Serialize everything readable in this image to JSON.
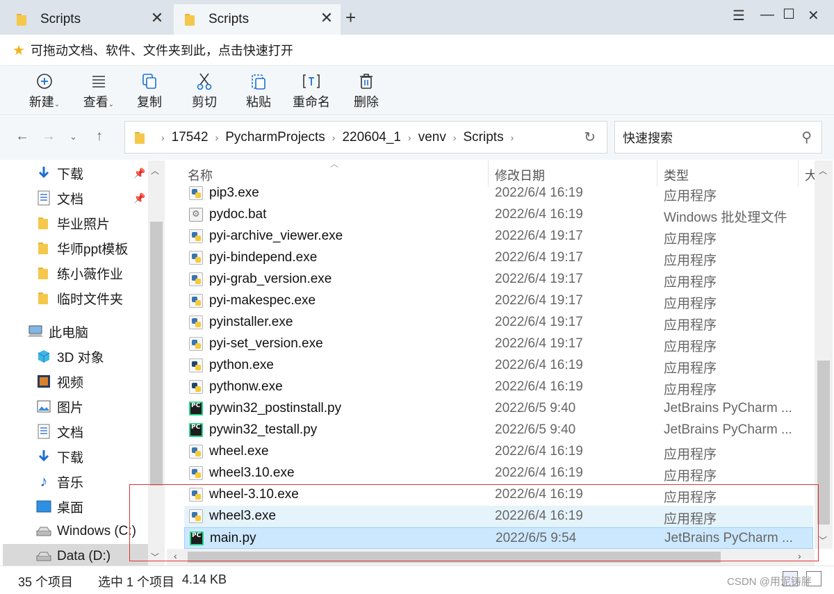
{
  "tabs": [
    {
      "label": "Scripts",
      "active": false
    },
    {
      "label": "Scripts",
      "active": true
    }
  ],
  "hint_bar": {
    "text": "可拖动文档、软件、文件夹到此，点击快速打开"
  },
  "toolbar": {
    "new": "新建",
    "view": "查看",
    "copy": "复制",
    "cut": "剪切",
    "paste": "粘贴",
    "rename": "重命名",
    "delete": "删除"
  },
  "breadcrumb": [
    "17542",
    "PycharmProjects",
    "220604_1",
    "venv",
    "Scripts"
  ],
  "search": {
    "placeholder": "快速搜索"
  },
  "nav": {
    "quick": [
      {
        "label": "下载",
        "icon": "download-icon",
        "pinned": true
      },
      {
        "label": "文档",
        "icon": "document-icon",
        "pinned": true
      },
      {
        "label": "毕业照片",
        "icon": "folder-icon",
        "pinned": false
      },
      {
        "label": "华师ppt模板",
        "icon": "folder-icon",
        "pinned": false
      },
      {
        "label": "练小薇作业",
        "icon": "folder-icon",
        "pinned": false
      },
      {
        "label": "临时文件夹",
        "icon": "folder-icon",
        "pinned": false
      }
    ],
    "this_pc": "此电脑",
    "pc_items": [
      {
        "label": "3D 对象",
        "icon": "3d-objects-icon"
      },
      {
        "label": "视频",
        "icon": "video-icon"
      },
      {
        "label": "图片",
        "icon": "pictures-icon"
      },
      {
        "label": "文档",
        "icon": "document-icon"
      },
      {
        "label": "下载",
        "icon": "download-icon"
      },
      {
        "label": "音乐",
        "icon": "music-icon"
      },
      {
        "label": "桌面",
        "icon": "desktop-icon"
      },
      {
        "label": "Windows (C:)",
        "icon": "drive-icon"
      },
      {
        "label": "Data (D:)",
        "icon": "drive-icon"
      }
    ]
  },
  "columns": {
    "name": "名称",
    "modified": "修改日期",
    "type": "类型",
    "size": "大"
  },
  "files": [
    {
      "name": "pip3.exe",
      "date": "2022/6/4 16:19",
      "type": "应用程序",
      "icon": "pyexe"
    },
    {
      "name": "pydoc.bat",
      "date": "2022/6/4 16:19",
      "type": "Windows 批处理文件",
      "icon": "bat"
    },
    {
      "name": "pyi-archive_viewer.exe",
      "date": "2022/6/4 19:17",
      "type": "应用程序",
      "icon": "pyexe"
    },
    {
      "name": "pyi-bindepend.exe",
      "date": "2022/6/4 19:17",
      "type": "应用程序",
      "icon": "pyexe"
    },
    {
      "name": "pyi-grab_version.exe",
      "date": "2022/6/4 19:17",
      "type": "应用程序",
      "icon": "pyexe"
    },
    {
      "name": "pyi-makespec.exe",
      "date": "2022/6/4 19:17",
      "type": "应用程序",
      "icon": "pyexe"
    },
    {
      "name": "pyinstaller.exe",
      "date": "2022/6/4 19:17",
      "type": "应用程序",
      "icon": "pyexe"
    },
    {
      "name": "pyi-set_version.exe",
      "date": "2022/6/4 19:17",
      "type": "应用程序",
      "icon": "pyexe"
    },
    {
      "name": "python.exe",
      "date": "2022/6/4 16:19",
      "type": "应用程序",
      "icon": "python"
    },
    {
      "name": "pythonw.exe",
      "date": "2022/6/4 16:19",
      "type": "应用程序",
      "icon": "python"
    },
    {
      "name": "pywin32_postinstall.py",
      "date": "2022/6/5 9:40",
      "type": "JetBrains PyCharm ...",
      "icon": "pycharm"
    },
    {
      "name": "pywin32_testall.py",
      "date": "2022/6/5 9:40",
      "type": "JetBrains PyCharm ...",
      "icon": "pycharm"
    },
    {
      "name": "wheel.exe",
      "date": "2022/6/4 16:19",
      "type": "应用程序",
      "icon": "pyexe"
    },
    {
      "name": "wheel3.10.exe",
      "date": "2022/6/4 16:19",
      "type": "应用程序",
      "icon": "pyexe"
    },
    {
      "name": "wheel-3.10.exe",
      "date": "2022/6/4 16:19",
      "type": "应用程序",
      "icon": "pyexe"
    },
    {
      "name": "wheel3.exe",
      "date": "2022/6/4 16:19",
      "type": "应用程序",
      "icon": "pyexe",
      "state": "hover"
    },
    {
      "name": "main.py",
      "date": "2022/6/5 9:54",
      "type": "JetBrains PyCharm ...",
      "icon": "pycharm",
      "state": "selected"
    }
  ],
  "status": {
    "count": "35 个项目",
    "selection": "选中 1 个项目",
    "size": "4.14 KB"
  },
  "watermark": "CSDN @用泥铸胖",
  "colors": {
    "accent": "#1a6fd1",
    "selected_row": "#cce8ff",
    "hover_row": "#e5f3fb",
    "highlight_box": "#e03131"
  }
}
